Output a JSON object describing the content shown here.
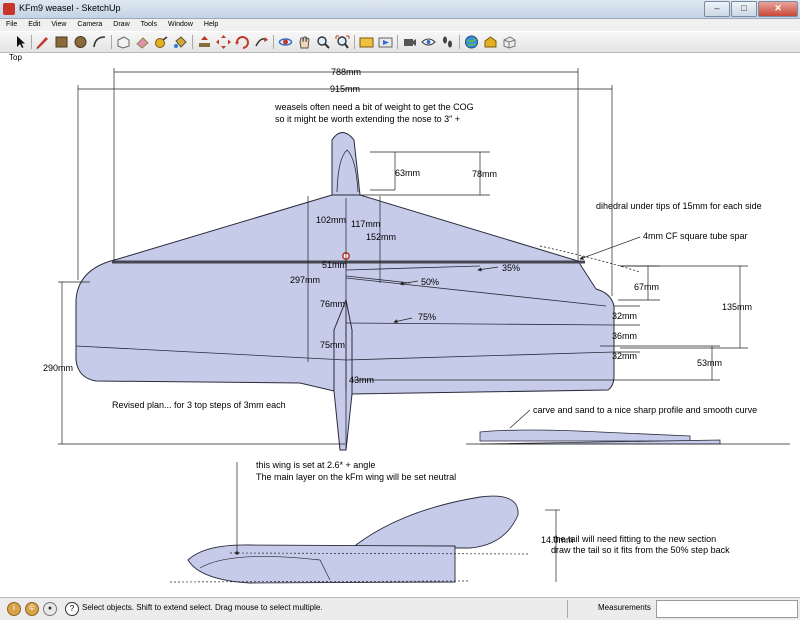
{
  "window": {
    "title": "KFm9 weasel - SketchUp"
  },
  "menu": [
    "File",
    "Edit",
    "View",
    "Camera",
    "Draw",
    "Tools",
    "Window",
    "Help"
  ],
  "toolbar": [
    {
      "name": "select-tool"
    },
    {
      "name": "pencil-tool"
    },
    {
      "name": "rectangle-tool"
    },
    {
      "name": "circle-tool"
    },
    {
      "name": "arc-tool"
    },
    {
      "name": "make-component-tool"
    },
    {
      "name": "eraser-tool"
    },
    {
      "name": "tape-measure-tool"
    },
    {
      "name": "paint-bucket-tool"
    },
    {
      "name": "push-pull-tool"
    },
    {
      "name": "move-tool"
    },
    {
      "name": "rotate-tool"
    },
    {
      "name": "orbit-tool"
    },
    {
      "name": "pan-tool"
    },
    {
      "name": "zoom-tool"
    },
    {
      "name": "zoom-extents-tool"
    },
    {
      "name": "previous-view-tool"
    },
    {
      "name": "next-view-tool"
    },
    {
      "name": "position-camera-tool"
    },
    {
      "name": "look-around-tool"
    },
    {
      "name": "walk-tool"
    },
    {
      "name": "get-models-tool"
    },
    {
      "name": "share-model-tool"
    },
    {
      "name": "component-library-tool"
    }
  ],
  "view_label": "Top",
  "drawing": {
    "dims": {
      "d788": "788mm",
      "d915": "915mm",
      "d63": "63mm",
      "d78": "78mm",
      "d102": "102mm",
      "d117": "117mm",
      "d152": "152mm",
      "d51": "51mm",
      "d297": "297mm",
      "d76": "76mm",
      "d75": "75mm",
      "d43": "43mm",
      "d290": "290mm",
      "d67": "67mm",
      "d135": "135mm",
      "d32a": "32mm",
      "d36": "36mm",
      "d32b": "32mm",
      "d53": "53mm",
      "d14": "14.0mm"
    },
    "percents": {
      "p35": "35%",
      "p50": "50%",
      "p75": "75%"
    },
    "notes": {
      "cog_line1": "weasels often need a bit of weight to get the COG",
      "cog_line2": "so it might be worth extending the nose to 3\" +",
      "dihedral": "dihedral under tips of 15mm for each side",
      "spar": "4mm CF square tube spar",
      "revised": "Revised plan... for 3 top steps of 3mm each",
      "carve": "carve and sand to a nice sharp profile and smooth curve",
      "angle_line1": "this wing is set at 2.6* + angle",
      "angle_line2": "The main layer on  the kFm wing will be set neutral",
      "tail_line1": "the tail will need fitting to the new section",
      "tail_line2": "draw the tail so it fits from the 50% step back"
    }
  },
  "colors": {
    "surface": "#c6cbea",
    "edge": "#2a2a3a",
    "spar": "#45464f",
    "cog": "#c0392b"
  },
  "status": {
    "text": "Select objects. Shift to extend select. Drag mouse to select multiple.",
    "measurements_label": "Measurements",
    "measurements_value": ""
  }
}
